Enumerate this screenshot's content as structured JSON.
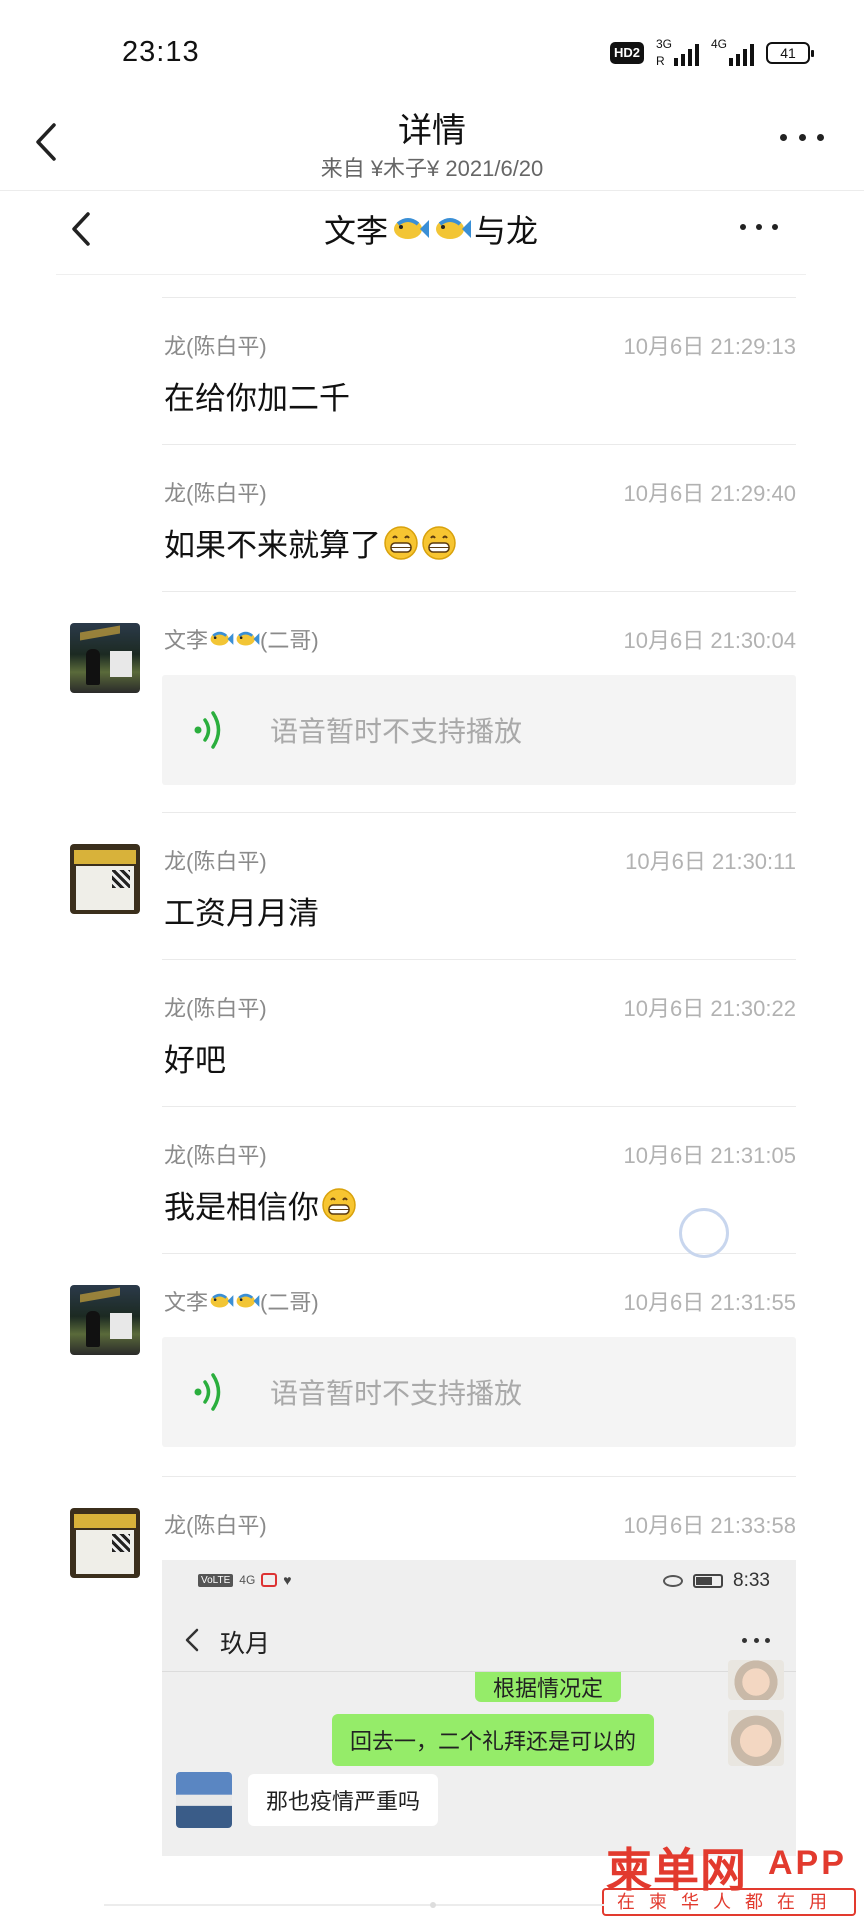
{
  "status_bar": {
    "time": "23:13",
    "hd_badge": "HD2",
    "network1": "3G",
    "network1_sub": "R",
    "network2": "4G",
    "battery": "41"
  },
  "header": {
    "title": "详情",
    "subtitle": "来自 ¥木子¥ 2021/6/20"
  },
  "chat": {
    "title_prefix": "文李",
    "title_suffix": "与龙",
    "messages": [
      {
        "sender": "龙(陈白平)",
        "time": "10月6日 21:29:13",
        "text": "在给你加二千"
      },
      {
        "sender": "龙(陈白平)",
        "time": "10月6日 21:29:40",
        "text": "如果不来就算了"
      },
      {
        "sender_prefix": "文李",
        "sender_suffix": "(二哥)",
        "time": "10月6日 21:30:04",
        "voice_text": "语音暂时不支持播放"
      },
      {
        "sender": "龙(陈白平)",
        "time": "10月6日 21:30:11",
        "text": "工资月月清"
      },
      {
        "sender": "龙(陈白平)",
        "time": "10月6日 21:30:22",
        "text": "好吧"
      },
      {
        "sender": "龙(陈白平)",
        "time": "10月6日 21:31:05",
        "text": "我是相信你"
      },
      {
        "sender_prefix": "文李",
        "sender_suffix": "(二哥)",
        "time": "10月6日 21:31:55",
        "voice_text": "语音暂时不支持播放"
      },
      {
        "sender": "龙(陈白平)",
        "time": "10月6日 21:33:58"
      }
    ],
    "screenshot": {
      "status_left": "VoLTE",
      "status_sig": "4G",
      "status_time": "8:33",
      "chat_title": "玖月",
      "bubble1": "根据情况定",
      "bubble2": "回去一，二个礼拜还是可以的",
      "bubble3": "那也疫情严重吗"
    }
  },
  "watermark": {
    "main": "柬单网",
    "app": "APP",
    "sub": "在柬华人都在用"
  },
  "colors": {
    "voice_green": "#2aae3d",
    "bubble_green": "#95ec69",
    "watermark_red": "#e23a2e"
  }
}
